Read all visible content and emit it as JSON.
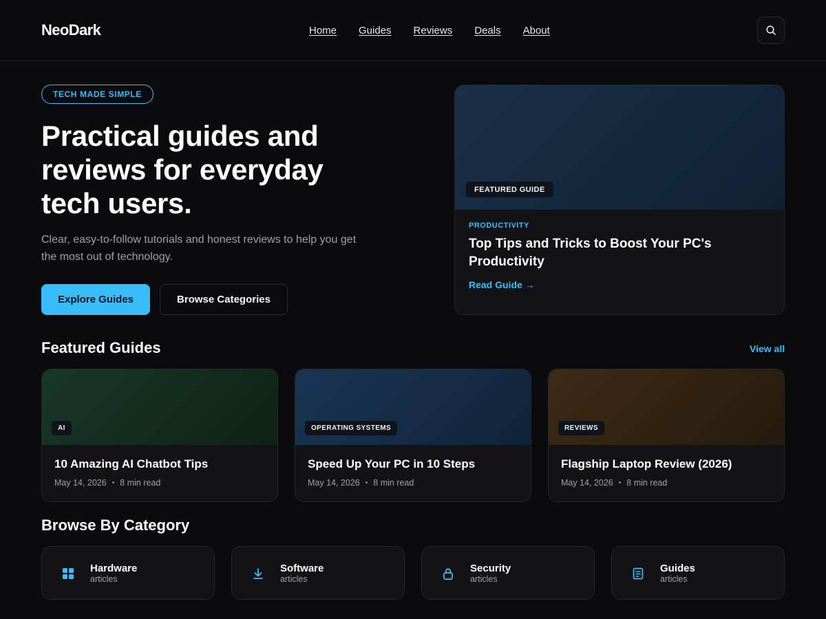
{
  "brand": {
    "logo": "NeoDark",
    "accent": "#38bdf8"
  },
  "nav": {
    "items": [
      "Home",
      "Guides",
      "Reviews",
      "Deals",
      "About"
    ],
    "search_icon": "search-icon"
  },
  "hero": {
    "tag": "TECH MADE SIMPLE",
    "title": "Practical guides and reviews for everyday tech users.",
    "subtitle": "Clear, easy-to-follow tutorials and honest reviews to help you get the most out of technology.",
    "primary_button": "Explore Guides",
    "secondary_button": "Browse Categories"
  },
  "featured_card": {
    "badge": "FEATURED GUIDE",
    "category": "PRODUCTIVITY",
    "title": "Top Tips and Tricks to Boost Your PC's Productivity",
    "link": "Read Guide →"
  },
  "featured_guides": {
    "title": "Featured Guides",
    "view_all": "View all",
    "cards": [
      {
        "badge": "AI",
        "title": "10 Amazing AI Chatbot Tips",
        "date": "May 14, 2026",
        "read_time": "8 min read",
        "color": "#14331f"
      },
      {
        "badge": "OPERATING SYSTEMS",
        "title": "Speed Up Your PC in 10 Steps",
        "date": "May 14, 2026",
        "read_time": "8 min read",
        "color": "#16304a"
      },
      {
        "badge": "REVIEWS",
        "title": "Flagship Laptop Review (2026)",
        "date": "May 14, 2026",
        "read_time": "8 min read",
        "color": "#3a2810"
      }
    ]
  },
  "categories": {
    "title": "Browse By Category",
    "items": [
      {
        "name": "Hardware",
        "sub": "articles",
        "icon": "grid-icon"
      },
      {
        "name": "Software",
        "sub": "articles",
        "icon": "download-icon"
      },
      {
        "name": "Security",
        "sub": "articles",
        "icon": "lock-icon"
      },
      {
        "name": "Guides",
        "sub": "articles",
        "icon": "document-icon"
      }
    ]
  }
}
